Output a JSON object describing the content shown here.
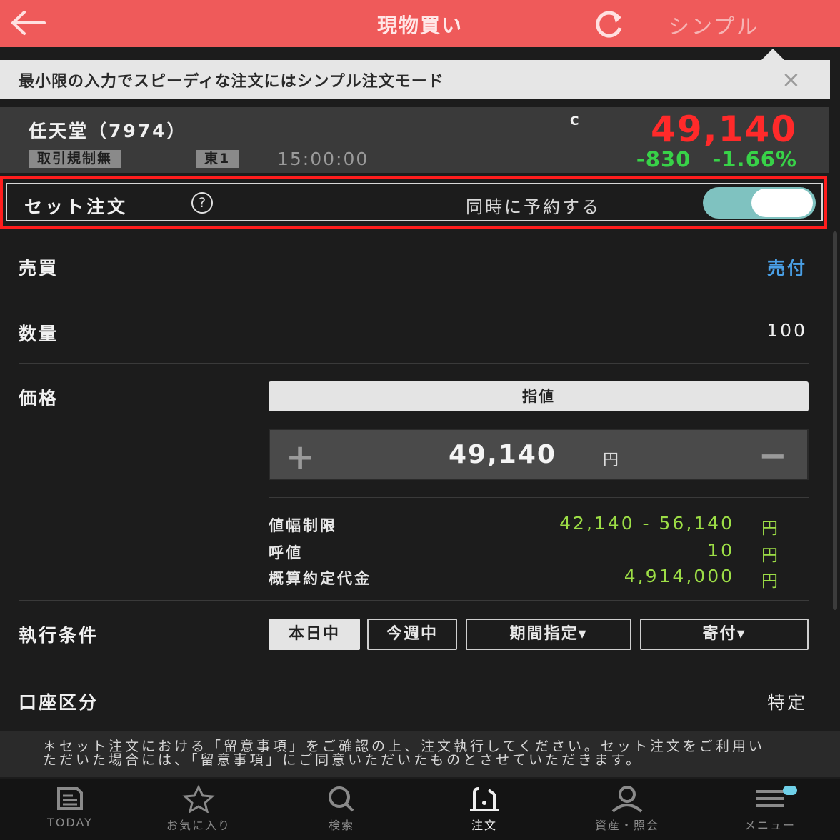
{
  "header": {
    "title": "現物買い",
    "simple_label": "シンプル"
  },
  "banner": {
    "text": "最小限の入力でスピーディな注文にはシンプル注文モード",
    "close": "×"
  },
  "stock": {
    "name": "任天堂（7974）",
    "tag_regulation": "取引規制無",
    "tag_market": "東1",
    "time": "15:00:00",
    "price_marker": "C",
    "price": "49,140",
    "change": "-830",
    "change_pct": "-1.66%",
    "price_color": "#ff2a2a",
    "change_color": "#38d248"
  },
  "set_order": {
    "label": "セット注文",
    "help": "?",
    "simultaneous_label": "同時に予約する",
    "toggle_on": true,
    "toggle_color": "#7fc2c0"
  },
  "form": {
    "trade": {
      "label": "売買",
      "value": "売付"
    },
    "quantity": {
      "label": "数量",
      "value": "100"
    },
    "price": {
      "label": "価格",
      "order_type": "指値",
      "value": "49,140",
      "unit": "円",
      "plus": "+",
      "minus": "−"
    },
    "info": {
      "limit_label": "値幅制限",
      "limit_value": "42,140 - 56,140",
      "tick_label": "呼値",
      "tick_value": "10",
      "estimate_label": "概算約定代金",
      "estimate_value": "4,914,000",
      "unit": "円"
    },
    "condition": {
      "label": "執行条件",
      "options": [
        "本日中",
        "今週中",
        "期間指定▾",
        "寄付▾"
      ],
      "selected": "本日中"
    },
    "account": {
      "label": "口座区分",
      "value": "特定"
    }
  },
  "notice": "＊セット注文における「留意事項」をご確認の上、注文執行してください。セット注文をご利用いただいた場合には、「留意事項」にご同意いただいたものとさせていただきます。",
  "nav": [
    {
      "label": "TODAY",
      "icon": "newspaper-icon"
    },
    {
      "label": "お気に入り",
      "icon": "star-icon"
    },
    {
      "label": "検索",
      "icon": "search-icon"
    },
    {
      "label": "注文",
      "icon": "order-icon",
      "active": true
    },
    {
      "label": "資産・照会",
      "icon": "person-icon"
    },
    {
      "label": "メニュー",
      "icon": "menu-icon"
    }
  ]
}
